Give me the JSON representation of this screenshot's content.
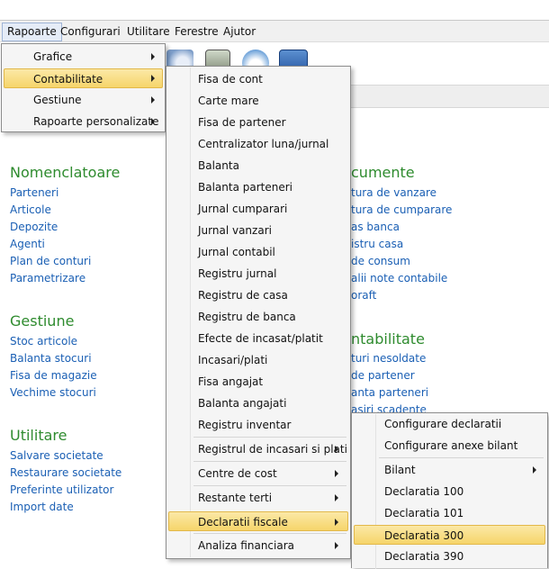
{
  "menubar": [
    "Rapoarte",
    "Configurari",
    "Utilitare",
    "Ferestre",
    "Ajutor"
  ],
  "left": {
    "nomenclatoare": {
      "title": "Nomenclatoare",
      "links": [
        "Parteneri",
        "Articole",
        "Depozite",
        "Agenti",
        "Plan de conturi",
        "Parametrizare"
      ]
    },
    "gestiune": {
      "title": "Gestiune",
      "links": [
        "Stoc articole",
        "Balanta stocuri",
        "Fisa de magazie",
        "Vechime stocuri"
      ]
    },
    "utilitare": {
      "title": "Utilitare",
      "links": [
        "Salvare societate",
        "Restaurare societate",
        "Preferinte utilizator",
        "Import date"
      ]
    }
  },
  "right": {
    "documente": {
      "title": "cumente",
      "links": [
        "tura de vanzare",
        "tura de cumparare",
        "as banca",
        "istru casa",
        "de consum",
        "alii note contabile",
        "oraft"
      ]
    },
    "contabilitate": {
      "title": "ntabilitate",
      "links": [
        "turi nesoldate",
        "de partener",
        "anta parteneri",
        "asiri scadente"
      ]
    }
  },
  "menu1": [
    "Grafice",
    "Contabilitate",
    "Gestiune",
    "Rapoarte personalizate"
  ],
  "menu2": [
    "Fisa de cont",
    "Carte mare",
    "Fisa de partener",
    "Centralizator luna/jurnal",
    "Balanta",
    "Balanta parteneri",
    "Jurnal cumparari",
    "Jurnal vanzari",
    "Jurnal contabil",
    "Registru jurnal",
    "Registru de casa",
    "Registru de banca",
    "Efecte de incasat/platit",
    "Incasari/plati",
    "Fisa angajat",
    "Balanta angajati",
    "Registru inventar",
    "Registrul de incasari si plati",
    "Centre de cost",
    "Restante terti",
    "Declaratii fiscale",
    "Analiza financiara"
  ],
  "menu3": [
    "Configurare declaratii",
    "Configurare anexe bilant",
    "Bilant",
    "Declaratia 100",
    "Declaratia 101",
    "Declaratia 300",
    "Declaratia 390"
  ]
}
